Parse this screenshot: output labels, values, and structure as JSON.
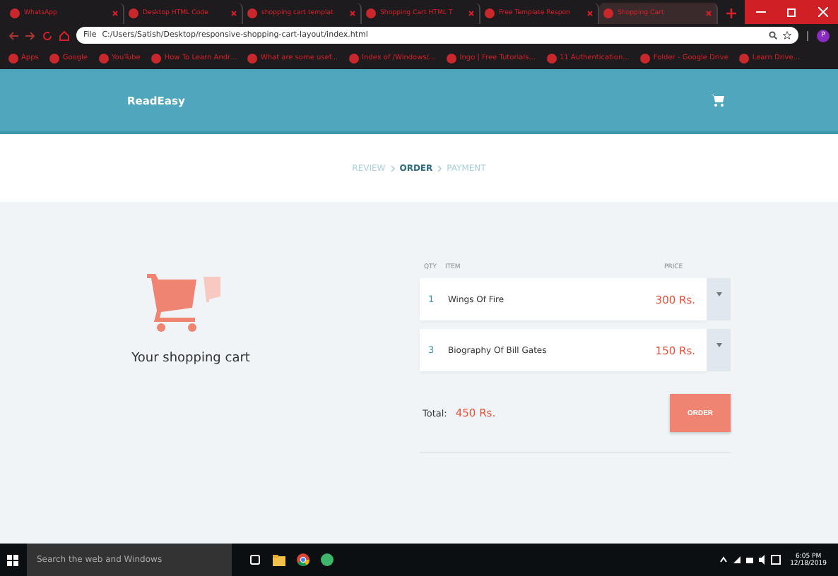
{
  "browser": {
    "tabs": [
      {
        "title": "WhatsApp",
        "selected": false
      },
      {
        "title": "Desktop HTML Code",
        "selected": false
      },
      {
        "title": "shopping cart templat",
        "selected": false
      },
      {
        "title": "Shopping Cart HTML T",
        "selected": false
      },
      {
        "title": "Free Template Respon",
        "selected": false
      },
      {
        "title": "Shopping Cart",
        "selected": true
      }
    ],
    "address": {
      "scheme": "File",
      "url": "C:/Users/Satish/Desktop/responsive-shopping-cart-layout/index.html"
    },
    "profile": "P",
    "bookmarks": [
      "Apps",
      "Google",
      "YouTube",
      "How To Learn Andr...",
      "What are some usef...",
      "Index of /Windows/...",
      "Ingo | Free Tutorials...",
      "11 Authentication...",
      "Folder - Google Drive",
      "Learn Drive..."
    ]
  },
  "header": {
    "brand": "ReadEasy"
  },
  "steps": [
    {
      "label": "REVIEW",
      "selected": false
    },
    {
      "label": "ORDER",
      "selected": true
    },
    {
      "label": "PAYMENT",
      "selected": false
    }
  ],
  "cart": {
    "caption": "Your shopping cart"
  },
  "table": {
    "columns": [
      "QTY",
      "ITEM",
      "PRICE"
    ],
    "rows": [
      {
        "qty": "1",
        "name": "Wings Of Fire",
        "price": "300 Rs."
      },
      {
        "qty": "3",
        "name": "Biography Of Bill Gates",
        "price": "150 Rs."
      }
    ]
  },
  "total": {
    "label": "Total:",
    "value": "450 Rs."
  },
  "order_button": "ORDER",
  "taskbar": {
    "search_placeholder": "Search the web and Windows",
    "time": "6:05 PM",
    "date": "12/18/2019"
  }
}
